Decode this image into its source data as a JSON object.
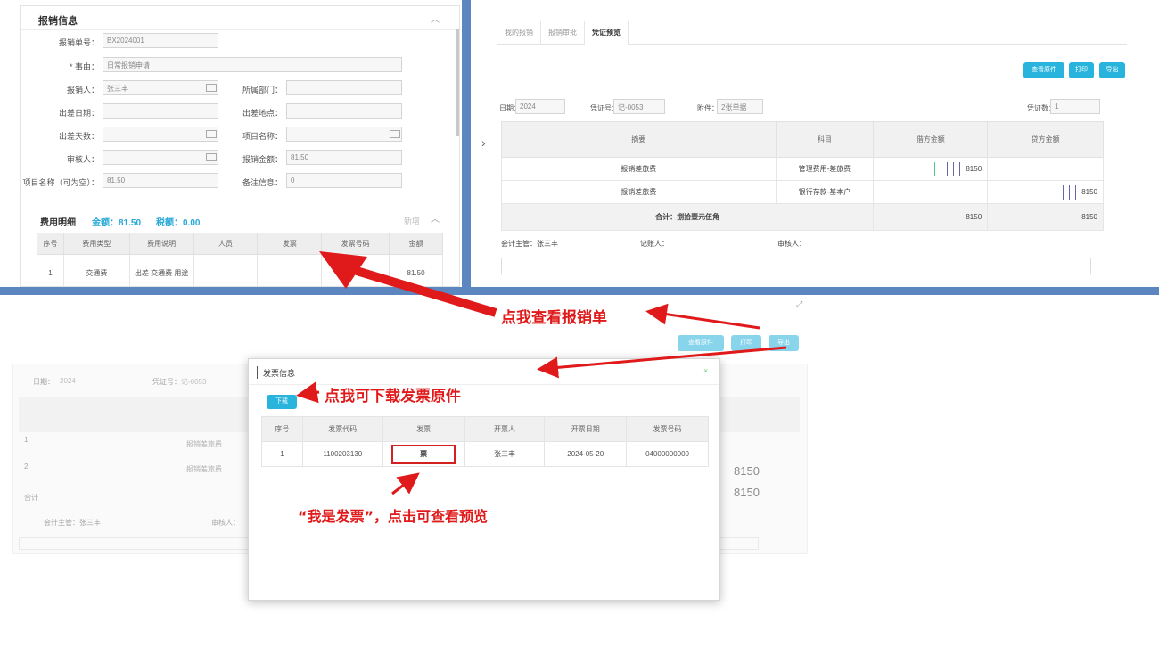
{
  "panelA": {
    "section_title": "报销信息",
    "fields": [
      {
        "label": "报销单号：",
        "value": "BX2024001"
      },
      {
        "label": "* 事由：",
        "value": "日常报销申请"
      },
      {
        "label": "报销人：",
        "value": "张三丰"
      },
      {
        "label": "所属部门：",
        "value": ""
      },
      {
        "label": "出差日期：",
        "value": ""
      },
      {
        "label": "出差地点：",
        "value": ""
      },
      {
        "label": "出差天数：",
        "value": ""
      },
      {
        "label": "项目名称：",
        "value": ""
      },
      {
        "label": "审核人：",
        "value": ""
      },
      {
        "label": "报销金额：",
        "value": "81.50"
      },
      {
        "label": "项目名称（可为空）：",
        "value": "81.50"
      },
      {
        "label": "备注信息：",
        "value": "0"
      }
    ],
    "detail_title": "费用明细",
    "amount_label": "金额：81.50",
    "tax_label": "税额：0.00",
    "add_link": "新增",
    "table": {
      "headers": [
        "序号",
        "费用类型",
        "费用说明",
        "人员",
        "发票",
        "发票号码",
        "金额"
      ],
      "rows": [
        [
          "1",
          "交通费",
          "出差 交通费 用途",
          "",
          "",
          "",
          "81.50"
        ]
      ]
    }
  },
  "panelB": {
    "tabs": [
      "我的报销",
      "报销审批",
      "凭证预览"
    ],
    "buttons": [
      "查看原件",
      "打印",
      "导出"
    ],
    "meta": [
      {
        "label": "日期：",
        "value": "2024"
      },
      {
        "label": "凭证号：",
        "value": "记-0053"
      },
      {
        "label": "附件：",
        "value": "2张单据"
      },
      {
        "label": "凭证数：",
        "value": "1"
      }
    ],
    "table": {
      "headers": [
        "摘要",
        "科目",
        "借方金额",
        "贷方金额"
      ],
      "rows": [
        {
          "summary": "报销差旅费",
          "account": "管理费用-差旅费",
          "debit": "8150",
          "credit": ""
        },
        {
          "summary": "报销差旅费",
          "account": "银行存款-基本户",
          "debit": "",
          "credit": "8150"
        }
      ],
      "total_label": "合计：捌拾壹元伍角",
      "total_debit": "8150",
      "total_credit": "8150"
    },
    "footer": [
      "会计主管：张三丰",
      "记账人：",
      "审核人："
    ]
  },
  "panelC": {
    "buttons": [
      "查看原件",
      "打印",
      "导出"
    ],
    "meta": [
      {
        "label": "日期：",
        "value": "2024"
      },
      {
        "label": "凭证号：",
        "value": "记-0053"
      }
    ],
    "rows": [
      {
        "idx": "1",
        "summary": "报销差旅费"
      },
      {
        "idx": "2",
        "summary": "报销差旅费"
      }
    ],
    "total": "合计",
    "footer": [
      "会计主管：张三丰",
      "审核人："
    ],
    "right_vals": [
      "8150",
      "8150"
    ]
  },
  "modal": {
    "title": "发票信息",
    "download_button": "下载",
    "headers": [
      "序号",
      "发票代码",
      "发票",
      "开票人",
      "开票日期",
      "发票号码"
    ],
    "row": [
      "1",
      "1100203130",
      "票",
      "张三丰",
      "2024-05-20",
      "04000000000"
    ]
  },
  "annotations": {
    "view_voucher": "点我查看报销单",
    "download_invoice": "点我可下载发票原件",
    "invoice_preview": "“我是发票”，点击可查看预览"
  },
  "colors": {
    "accent": "#28b4dc",
    "arrow": "#e01a1a",
    "divider": "#5b86c0"
  }
}
